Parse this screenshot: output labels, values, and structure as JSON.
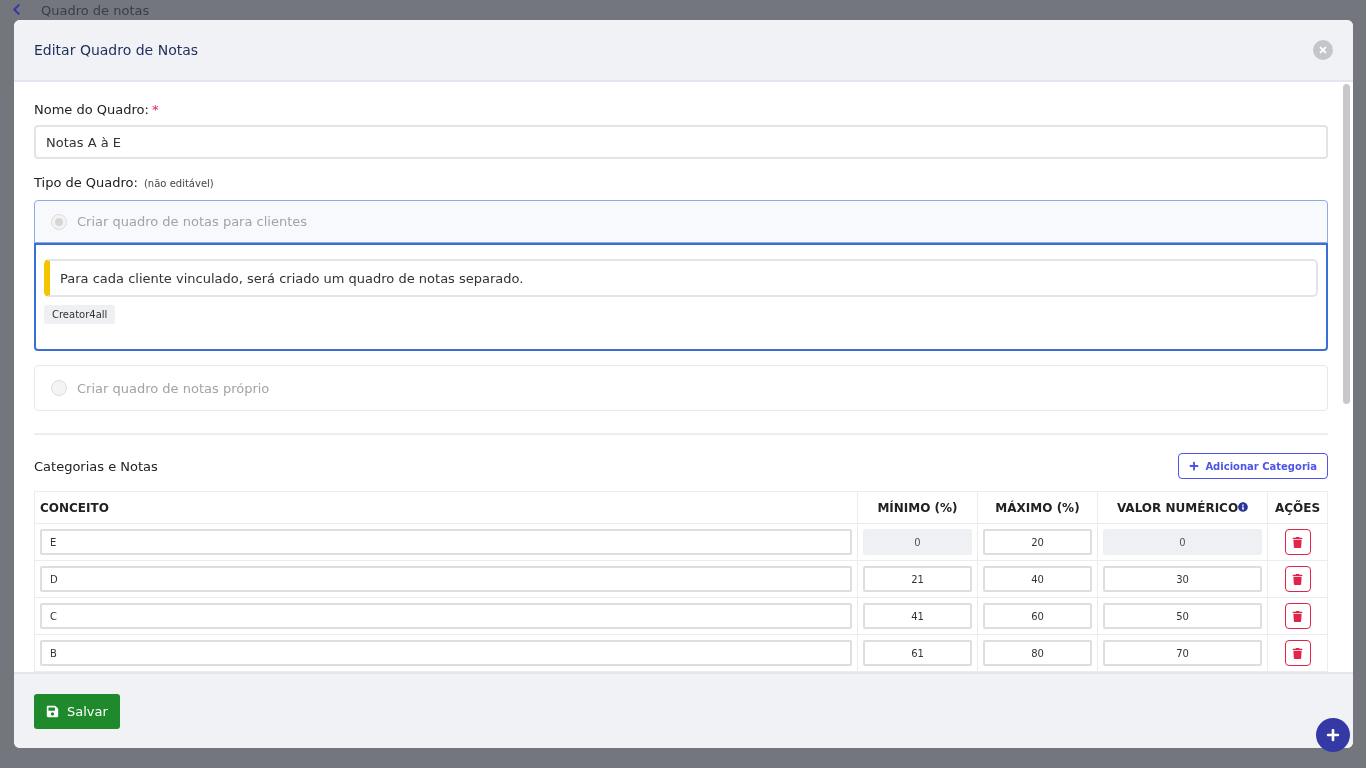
{
  "background_page": {
    "title": "Quadro de notas"
  },
  "dialog": {
    "title": "Editar Quadro de Notas"
  },
  "name_field": {
    "label": "Nome do Quadro:",
    "required_mark": "*",
    "value": "Notas A à E"
  },
  "board_type": {
    "label": "Tipo de Quadro:",
    "note": "(não editável)",
    "options": [
      {
        "label": "Criar quadro de notas para clientes",
        "selected": true,
        "disabled": true,
        "description": "Para cada cliente vinculado, será criado um quadro de notas separado.",
        "tags": [
          "Creator4all"
        ]
      },
      {
        "label": "Criar quadro de notas próprio",
        "selected": false,
        "disabled": true
      }
    ]
  },
  "categories": {
    "title": "Categorias e Notas",
    "add_button": "Adicionar Categoria",
    "columns": [
      "CONCEITO",
      "MÍNIMO (%)",
      "MÁXIMO (%)",
      "VALOR NUMÉRICO",
      "AÇÕES"
    ],
    "rows": [
      {
        "concept": "E",
        "minimum": {
          "value": "0",
          "disabled": true
        },
        "maximum": {
          "value": "20",
          "disabled": false
        },
        "numeric": {
          "value": "0",
          "disabled": true
        }
      },
      {
        "concept": "D",
        "minimum": {
          "value": "21",
          "disabled": false
        },
        "maximum": {
          "value": "40",
          "disabled": false
        },
        "numeric": {
          "value": "30",
          "disabled": false
        }
      },
      {
        "concept": "C",
        "minimum": {
          "value": "41",
          "disabled": false
        },
        "maximum": {
          "value": "60",
          "disabled": false
        },
        "numeric": {
          "value": "50",
          "disabled": false
        }
      },
      {
        "concept": "B",
        "minimum": {
          "value": "61",
          "disabled": false
        },
        "maximum": {
          "value": "80",
          "disabled": false
        },
        "numeric": {
          "value": "70",
          "disabled": false
        }
      }
    ]
  },
  "footer": {
    "save_button": "Salvar"
  }
}
